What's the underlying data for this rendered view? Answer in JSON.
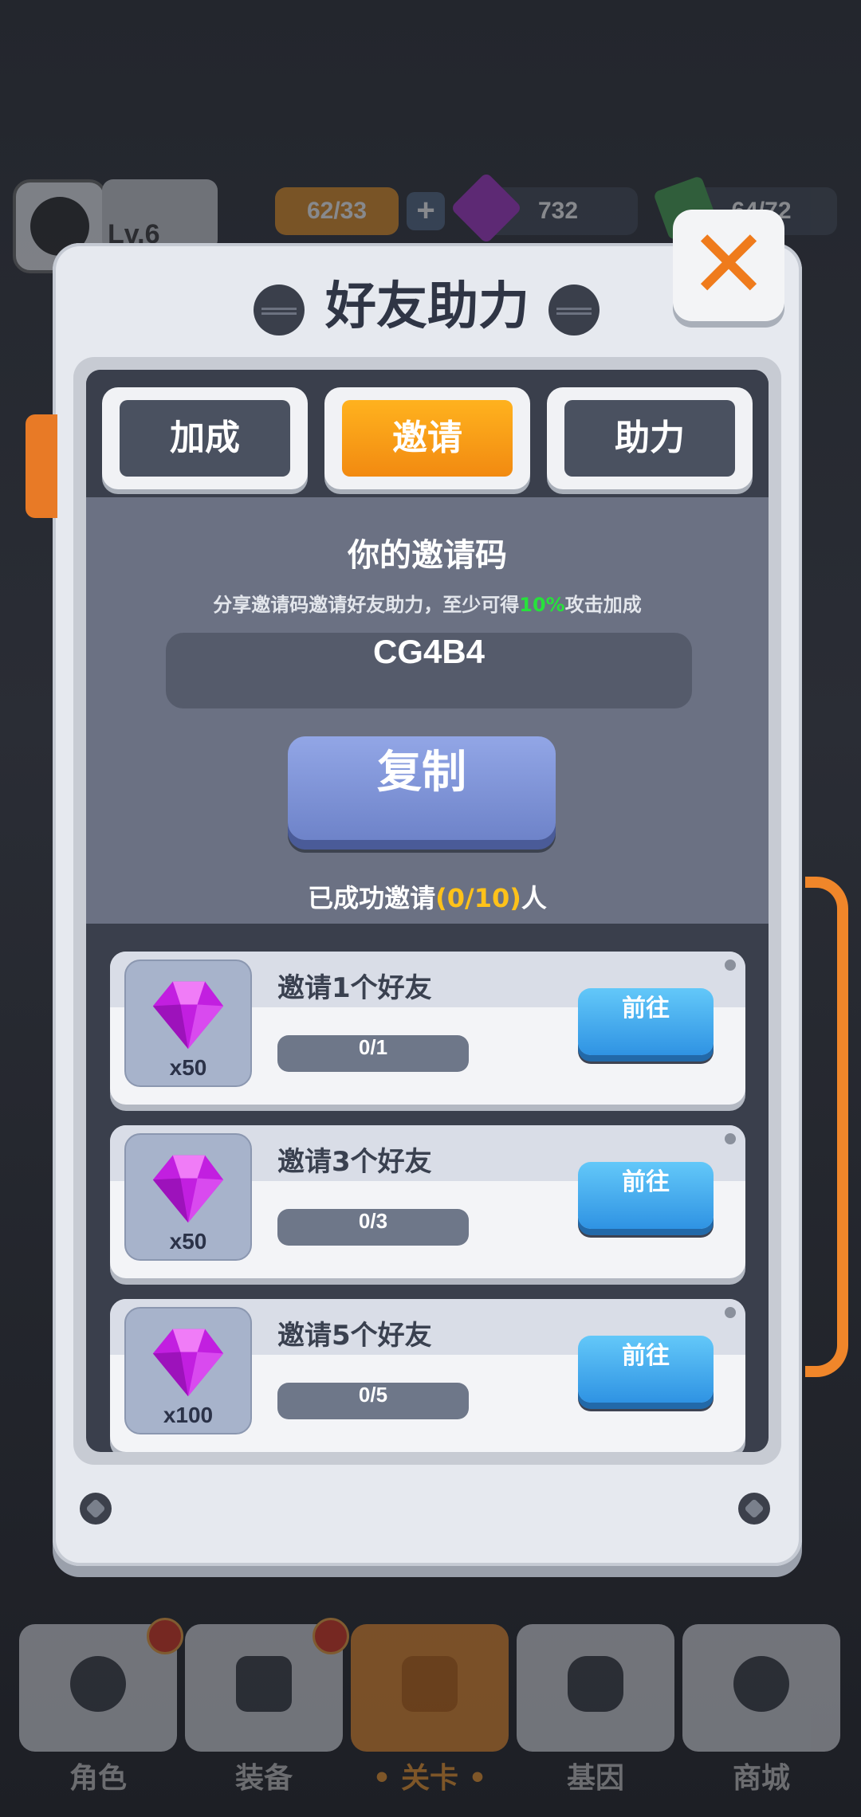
{
  "topbar": {
    "level": "Lv.6",
    "energy": "62/33",
    "gems": "732",
    "cash": "64/72"
  },
  "modal": {
    "title": "好友助力",
    "tabs": [
      {
        "label": "加成",
        "active": false
      },
      {
        "label": "邀请",
        "active": true
      },
      {
        "label": "助力",
        "active": false
      }
    ],
    "invite": {
      "title": "你的邀请码",
      "desc_prefix": "分享邀请码邀请好友助力，至少可得",
      "desc_highlight": "10%",
      "desc_suffix": "攻击加成",
      "code": "CG4B4",
      "copy_label": "复制",
      "invited_prefix": "已成功邀请",
      "invited_count": "(0/10)",
      "invited_suffix": "人"
    },
    "tasks": [
      {
        "title": "邀请1个好友",
        "reward_qty": "x50",
        "progress": "0/1",
        "button": "前往"
      },
      {
        "title": "邀请3个好友",
        "reward_qty": "x50",
        "progress": "0/3",
        "button": "前往"
      },
      {
        "title": "邀请5个好友",
        "reward_qty": "x100",
        "progress": "0/5",
        "button": "前往"
      }
    ]
  },
  "bottom_nav": [
    {
      "label": "角色",
      "icon": "skull-icon",
      "badge": true
    },
    {
      "label": "装备",
      "icon": "gun-icon",
      "badge": true
    },
    {
      "label": "• 关卡 •",
      "icon": "map-pin-icon",
      "active": true
    },
    {
      "label": "基因",
      "icon": "hexagon-icon"
    },
    {
      "label": "商城",
      "icon": "shop-icon"
    }
  ],
  "colors": {
    "accent_orange": "#f28a11",
    "highlight_green": "#27e13c",
    "highlight_yellow": "#ffc21a",
    "button_blue": "#2f93e3",
    "gem_purple": "#c21fe0"
  }
}
